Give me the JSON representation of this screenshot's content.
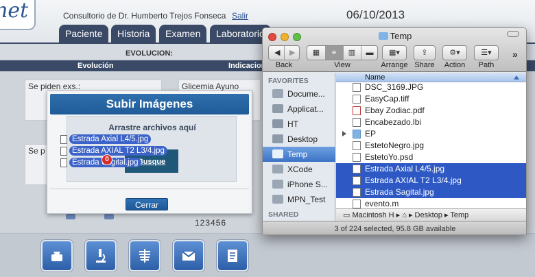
{
  "app": {
    "logo_text": "net",
    "clinic_name": "Consultorio de Dr. Humberto Trejos Fonseca",
    "logout_label": "Salir",
    "date": "06/10/2013",
    "tabs": [
      "Paciente",
      "Historia",
      "Examen",
      "Laboratorio"
    ],
    "section_title": "EVOLUCION:",
    "columns": [
      "Evolución",
      "Indicacion"
    ],
    "notes": [
      "Se piden exs.:",
      "Glicemia Ayuno",
      "Se p"
    ],
    "pager": "123456"
  },
  "modal": {
    "title": "Subir Imágenes",
    "drop_label": "Arrastre archivos aquí",
    "dragged_files": [
      "Estrada Axial L4/5.jpg",
      "Estrada AXIAL T2 L3/4.jpg",
      "Estrada Sagital.jpg"
    ],
    "badge_count": "0",
    "browse_label": "Busque",
    "close_label": "Cerrar"
  },
  "finder": {
    "window_title": "Temp",
    "toolbar": {
      "back_label": "Back",
      "view_label": "View",
      "arrange_label": "Arrange",
      "share_label": "Share",
      "action_label": "Action",
      "path_label": "Path"
    },
    "sidebar": {
      "favorites_label": "FAVORITES",
      "shared_label": "SHARED",
      "items": [
        "Docume...",
        "Applicat...",
        "HT",
        "Desktop",
        "Temp",
        "XCode",
        "iPhone S...",
        "MPN_Test"
      ]
    },
    "column_name": "Name",
    "files": [
      {
        "name": "DSC_3169.JPG",
        "selected": false,
        "folder": false
      },
      {
        "name": "EasyCap.tiff",
        "selected": false,
        "folder": false
      },
      {
        "name": "Ebay Zodiac.pdf",
        "selected": false,
        "folder": false
      },
      {
        "name": "Encabezado.lbi",
        "selected": false,
        "folder": false
      },
      {
        "name": "EP",
        "selected": false,
        "folder": true
      },
      {
        "name": "EstetoNegro.jpg",
        "selected": false,
        "folder": false
      },
      {
        "name": "EstetoYo.psd",
        "selected": false,
        "folder": false
      },
      {
        "name": "Estrada Axial L4/5.jpg",
        "selected": true,
        "folder": false
      },
      {
        "name": "Estrada AXIAL T2 L3/4.jpg",
        "selected": true,
        "folder": false
      },
      {
        "name": "Estrada Sagital.jpg",
        "selected": true,
        "folder": false
      },
      {
        "name": "evento.m",
        "selected": false,
        "folder": false
      }
    ],
    "path_bar": [
      "Macintosh H",
      "Desktop",
      "Temp"
    ],
    "status": "3 of 224 selected, 95.8 GB available"
  },
  "colors": {
    "nav_dark": "#3a4a66",
    "modal_title": "#1f5c98",
    "finder_selection": "#2e59c4",
    "badge_red": "#d82a2a"
  }
}
